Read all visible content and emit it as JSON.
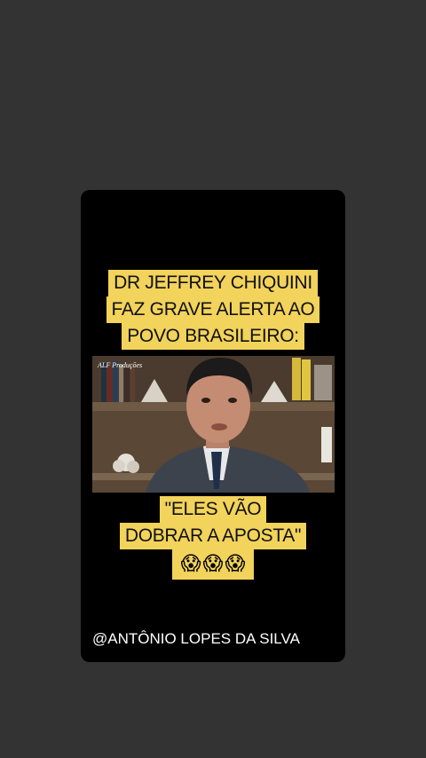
{
  "headline": {
    "lines": [
      "DR JEFFREY CHIQUINI",
      "FAZ GRAVE ALERTA AO",
      "POVO BRASILEIRO:"
    ]
  },
  "video": {
    "watermark": "ALF Produções"
  },
  "quote": {
    "lines": [
      "\"ELES VÃO",
      "DOBRAR A APOSTA\""
    ],
    "emojis": [
      "😱",
      "😱",
      "😱"
    ]
  },
  "credit": "@ANTÔNIO LOPES DA SILVA",
  "colors": {
    "background": "#333333",
    "card": "#000000",
    "caption_highlight": "#f2d35b"
  }
}
